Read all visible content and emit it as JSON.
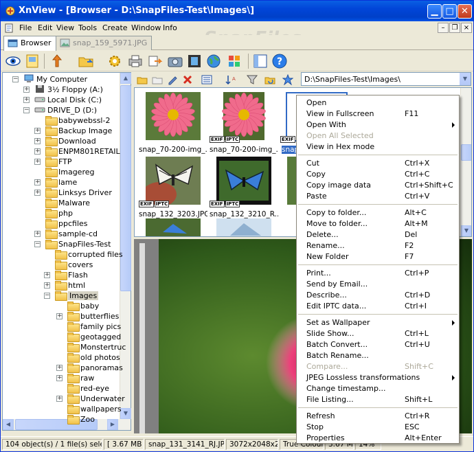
{
  "window": {
    "title": "XnView - [Browser - D:\\SnapFiles-Test\\Images\\]"
  },
  "menu": [
    "File",
    "Edit",
    "View",
    "Tools",
    "Create",
    "Window",
    "Info"
  ],
  "watermark": "SnapFiles",
  "tabs": [
    {
      "label": "Browser",
      "active": true
    },
    {
      "label": "snap_159_5971.JPG",
      "active": false
    }
  ],
  "path": "D:\\SnapFiles-Test\\Images\\",
  "tree": [
    {
      "label": "My Computer",
      "level": 0,
      "icon": "computer-icon",
      "exp": "-"
    },
    {
      "label": "3½ Floppy (A:)",
      "level": 1,
      "icon": "floppy-icon",
      "exp": "+"
    },
    {
      "label": "Local Disk (C:)",
      "level": 1,
      "icon": "drive-icon",
      "exp": "+"
    },
    {
      "label": "DRIVE_D (D:)",
      "level": 1,
      "icon": "drive-icon",
      "exp": "-"
    },
    {
      "label": "babywebssl-2",
      "level": 2,
      "icon": "folder-icon",
      "exp": ""
    },
    {
      "label": "Backup Image",
      "level": 2,
      "icon": "folder-icon",
      "exp": "+"
    },
    {
      "label": "Download",
      "level": 2,
      "icon": "folder-icon",
      "exp": "+"
    },
    {
      "label": "ENPM801RETAIL",
      "level": 2,
      "icon": "folder-icon",
      "exp": "+"
    },
    {
      "label": "FTP",
      "level": 2,
      "icon": "folder-icon",
      "exp": "+"
    },
    {
      "label": "Imagereg",
      "level": 2,
      "icon": "folder-icon",
      "exp": ""
    },
    {
      "label": "lame",
      "level": 2,
      "icon": "folder-icon",
      "exp": "+"
    },
    {
      "label": "Linksys Driver",
      "level": 2,
      "icon": "folder-icon",
      "exp": "+"
    },
    {
      "label": "Malware",
      "level": 2,
      "icon": "folder-icon",
      "exp": ""
    },
    {
      "label": "php",
      "level": 2,
      "icon": "folder-icon",
      "exp": ""
    },
    {
      "label": "ppcfiles",
      "level": 2,
      "icon": "folder-icon",
      "exp": ""
    },
    {
      "label": "sample-cd",
      "level": 2,
      "icon": "folder-icon",
      "exp": "+"
    },
    {
      "label": "SnapFiles-Test",
      "level": 2,
      "icon": "folder-icon",
      "exp": "-"
    },
    {
      "label": "corrupted files",
      "level": 3,
      "icon": "folder-icon",
      "exp": ""
    },
    {
      "label": "covers",
      "level": 3,
      "icon": "folder-icon",
      "exp": ""
    },
    {
      "label": "Flash",
      "level": 3,
      "icon": "folder-icon",
      "exp": "+"
    },
    {
      "label": "html",
      "level": 3,
      "icon": "folder-icon",
      "exp": "+"
    },
    {
      "label": "Images",
      "level": 3,
      "icon": "folder-open-icon",
      "exp": "-",
      "selected": true
    },
    {
      "label": "baby",
      "level": 4,
      "icon": "folder-icon",
      "exp": ""
    },
    {
      "label": "butterflies",
      "level": 4,
      "icon": "folder-icon",
      "exp": "+"
    },
    {
      "label": "family pics",
      "level": 4,
      "icon": "folder-icon",
      "exp": ""
    },
    {
      "label": "geotagged",
      "level": 4,
      "icon": "folder-icon",
      "exp": ""
    },
    {
      "label": "Monstertruc",
      "level": 4,
      "icon": "folder-icon",
      "exp": ""
    },
    {
      "label": "old photos",
      "level": 4,
      "icon": "folder-icon",
      "exp": ""
    },
    {
      "label": "panoramas",
      "level": 4,
      "icon": "folder-icon",
      "exp": "+"
    },
    {
      "label": "raw",
      "level": 4,
      "icon": "folder-icon",
      "exp": "+"
    },
    {
      "label": "red-eye",
      "level": 4,
      "icon": "folder-icon",
      "exp": ""
    },
    {
      "label": "Underwater",
      "level": 4,
      "icon": "folder-icon",
      "exp": "+"
    },
    {
      "label": "wallpapers",
      "level": 4,
      "icon": "folder-icon",
      "exp": ""
    },
    {
      "label": "Zoo",
      "level": 4,
      "icon": "folder-icon",
      "exp": ""
    }
  ],
  "thumbnails": [
    {
      "label": "snap_70-200-img_...",
      "kind": "flower",
      "badges": []
    },
    {
      "label": "snap_70-200-img_...",
      "kind": "flower",
      "badges": [
        "EXIF",
        "IPTC"
      ]
    },
    {
      "label": "snap_",
      "kind": "selected",
      "badges": [
        "EXIF"
      ]
    },
    {
      "label": "snap_132_3203.JPG",
      "kind": "butterfly-white",
      "badges": [
        "EXIF",
        "IPTC"
      ]
    },
    {
      "label": "snap_132_3210_R...",
      "kind": "butterfly-blue",
      "badges": [
        "EXIF",
        "IPTC"
      ]
    },
    {
      "label": "",
      "kind": "partial",
      "badges": []
    },
    {
      "label": "",
      "kind": "partial",
      "badges": []
    },
    {
      "label": "",
      "kind": "partial",
      "badges": []
    }
  ],
  "context_menu": [
    {
      "label": "Open",
      "shortcut": ""
    },
    {
      "label": "View in Fullscreen",
      "shortcut": "F11"
    },
    {
      "label": "Open With",
      "shortcut": "",
      "submenu": true
    },
    {
      "label": "Open All Selected",
      "shortcut": "",
      "disabled": true
    },
    {
      "label": "View in Hex mode",
      "shortcut": ""
    },
    {
      "sep": true
    },
    {
      "label": "Cut",
      "shortcut": "Ctrl+X"
    },
    {
      "label": "Copy",
      "shortcut": "Ctrl+C"
    },
    {
      "label": "Copy image data",
      "shortcut": "Ctrl+Shift+C"
    },
    {
      "label": "Paste",
      "shortcut": "Ctrl+V"
    },
    {
      "sep": true
    },
    {
      "label": "Copy to folder...",
      "shortcut": "Alt+C"
    },
    {
      "label": "Move to folder...",
      "shortcut": "Alt+M"
    },
    {
      "label": "Delete...",
      "shortcut": "Del"
    },
    {
      "label": "Rename...",
      "shortcut": "F2"
    },
    {
      "label": "New Folder",
      "shortcut": "F7"
    },
    {
      "sep": true
    },
    {
      "label": "Print...",
      "shortcut": "Ctrl+P"
    },
    {
      "label": "Send by Email...",
      "shortcut": ""
    },
    {
      "label": "Describe...",
      "shortcut": "Ctrl+D"
    },
    {
      "label": "Edit IPTC data...",
      "shortcut": "Ctrl+I"
    },
    {
      "sep": true
    },
    {
      "label": "Set as Wallpaper",
      "shortcut": "",
      "submenu": true
    },
    {
      "label": "Slide Show...",
      "shortcut": "Ctrl+L"
    },
    {
      "label": "Batch Convert...",
      "shortcut": "Ctrl+U"
    },
    {
      "label": "Batch Rename...",
      "shortcut": ""
    },
    {
      "label": "Compare...",
      "shortcut": "Shift+C",
      "disabled": true
    },
    {
      "label": "JPEG Lossless transformations",
      "shortcut": "",
      "submenu": true
    },
    {
      "label": "Change timestamp...",
      "shortcut": ""
    },
    {
      "label": "File Listing...",
      "shortcut": "Shift+L"
    },
    {
      "sep": true
    },
    {
      "label": "Refresh",
      "shortcut": "Ctrl+R"
    },
    {
      "label": "Stop",
      "shortcut": "ESC"
    },
    {
      "label": "Properties",
      "shortcut": "Alt+Enter"
    }
  ],
  "status": {
    "objects": "104 object(s) / 1 file(s) selected",
    "size": "[ 3.67 MB ]",
    "filename": "snap_131_3141_RJ.JPG",
    "dimensions": "3072x2048x24",
    "colours": "True Colours",
    "filesize": "3.67 MB",
    "zoom": "14%"
  },
  "colors": {
    "title_blue": "#0145d8",
    "menu_bg": "#ece9d8",
    "selection": "#316ac5",
    "flower_pink": "#f06b8c"
  }
}
